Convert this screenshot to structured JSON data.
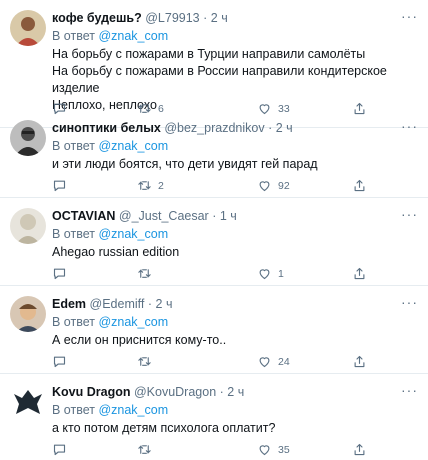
{
  "tweets": [
    {
      "name": "кофе будешь?",
      "handle": "@L79913",
      "time": "2 ч",
      "reply_prefix": "В ответ",
      "reply_to": "@znak_com",
      "lines": [
        "На борьбу с пожарами в Турции направили самолёты",
        "На борьбу с пожарами в России направили кондитерское изделие",
        "Неплохо, неплохо"
      ],
      "retweets": "6",
      "likes": "33"
    },
    {
      "name": "синоптики белых",
      "handle": "@bez_prazdnikov",
      "time": "2 ч",
      "reply_prefix": "В ответ",
      "reply_to": "@znak_com",
      "lines": [
        "и эти люди боятся, что дети увидят гей парад"
      ],
      "retweets": "2",
      "likes": "92"
    },
    {
      "name": "OCTAVIAN",
      "handle": "@_Just_Caesar",
      "time": "1 ч",
      "reply_prefix": "В ответ",
      "reply_to": "@znak_com",
      "lines": [
        "Ahegao russian edition"
      ],
      "retweets": "",
      "likes": "1"
    },
    {
      "name": "Edem",
      "handle": "@Edemiff",
      "time": "2 ч",
      "reply_prefix": "В ответ",
      "reply_to": "@znak_com",
      "lines": [
        "А если он приснится кому-то.."
      ],
      "retweets": "",
      "likes": "24"
    },
    {
      "name": "Kovu Dragon",
      "handle": "@KovuDragon",
      "time": "2 ч",
      "reply_prefix": "В ответ",
      "reply_to": "@znak_com",
      "lines": [
        "а кто потом детям психолога оплатит?"
      ],
      "retweets": "",
      "likes": "35"
    }
  ],
  "separator": "·",
  "more_glyph": "···",
  "icons": {
    "reply": "comment-icon",
    "retweet": "retweet-icon",
    "like": "heart-icon",
    "share": "share-icon"
  },
  "colors": {
    "text": "#0f1419",
    "secondary": "#5b7083",
    "link": "#1b95e0",
    "divider": "#e6ecf0"
  }
}
